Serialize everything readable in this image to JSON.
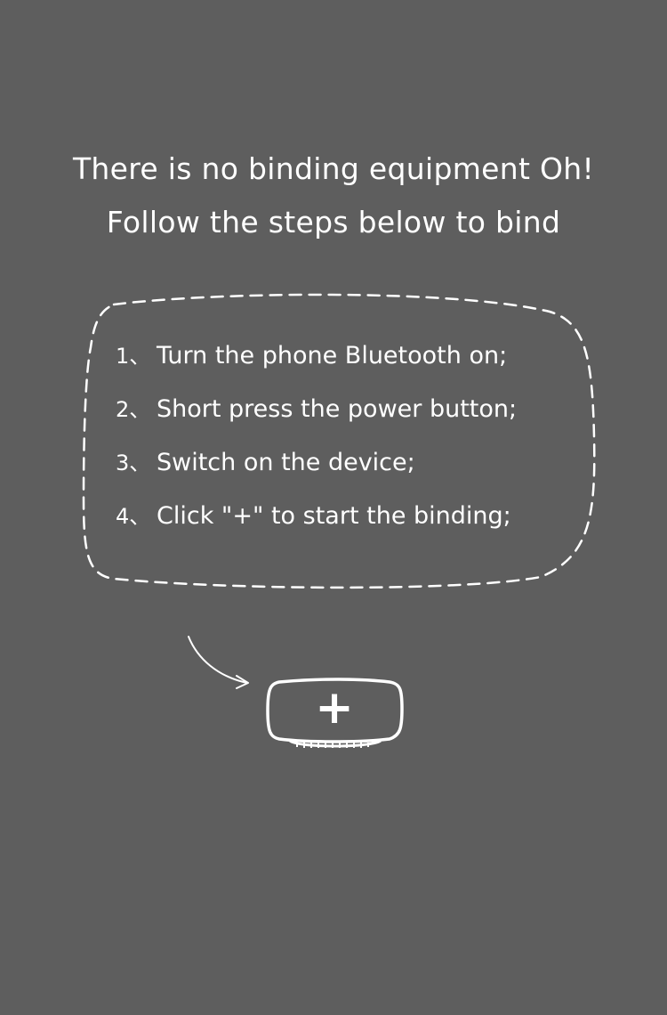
{
  "empty_state": {
    "title_line1": "There is no binding equipment Oh!",
    "title_line2": "Follow the steps below to bind"
  },
  "steps": [
    {
      "number": "1、",
      "text": "Turn the phone Bluetooth on;"
    },
    {
      "number": "2、",
      "text": "Short press the power button;"
    },
    {
      "number": "3、",
      "text": "Switch on the device;"
    },
    {
      "number": "4、",
      "text": "Click \"+\" to start the binding;"
    }
  ],
  "add_button": {
    "label": "+",
    "icon": "plus-icon"
  },
  "colors": {
    "background": "#5e5e5e",
    "foreground": "#ffffff"
  }
}
